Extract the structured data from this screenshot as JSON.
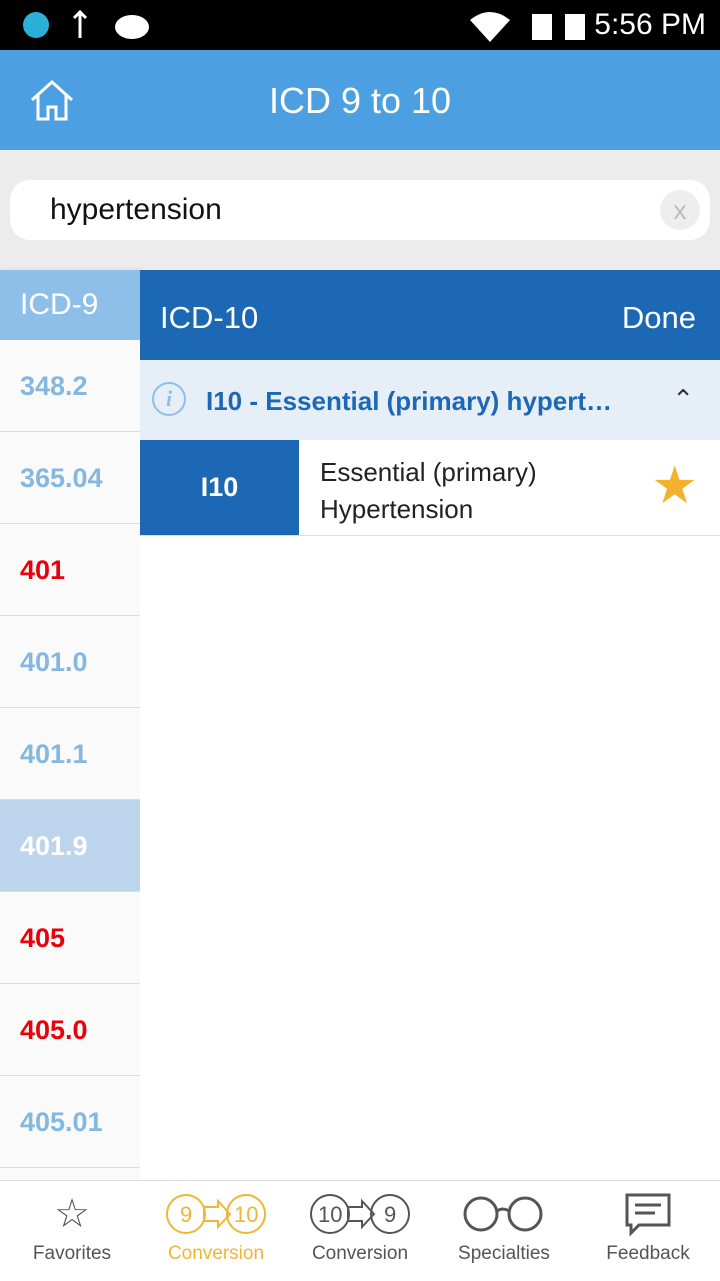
{
  "status": {
    "time": "5:56 PM"
  },
  "header": {
    "title": "ICD 9 to 10"
  },
  "search": {
    "value": "hypertension",
    "clear": "x"
  },
  "icd9": {
    "header": "ICD-9",
    "rows": [
      {
        "code": "348.2",
        "color": "blue"
      },
      {
        "code": "365.04",
        "color": "blue"
      },
      {
        "code": "401",
        "color": "red"
      },
      {
        "code": "401.0",
        "color": "blue"
      },
      {
        "code": "401.1",
        "color": "blue"
      },
      {
        "code": "401.9",
        "color": "selected"
      },
      {
        "code": "405",
        "color": "red"
      },
      {
        "code": "405.0",
        "color": "red"
      },
      {
        "code": "405.01",
        "color": "blue"
      }
    ]
  },
  "icd10": {
    "header": "ICD-10",
    "done": "Done",
    "group": {
      "title": "I10 - Essential (primary) hypert…",
      "expanded": true
    },
    "items": [
      {
        "code": "I10",
        "line1": "Essential (primary)",
        "line2": "Hypertension",
        "favorite": true
      }
    ]
  },
  "nav": [
    {
      "label": "Favorites",
      "icon": "star-outline-icon"
    },
    {
      "label": "Conversion",
      "icon": "9-to-10-icon",
      "active": true
    },
    {
      "label": "Conversion",
      "icon": "10-to-9-icon"
    },
    {
      "label": "Specialties",
      "icon": "glasses-icon"
    },
    {
      "label": "Feedback",
      "icon": "feedback-icon"
    }
  ],
  "colors": {
    "header": "#4c9fe0",
    "panel": "#1c68b4",
    "red": "#e8000a",
    "active": "#f0b534"
  }
}
